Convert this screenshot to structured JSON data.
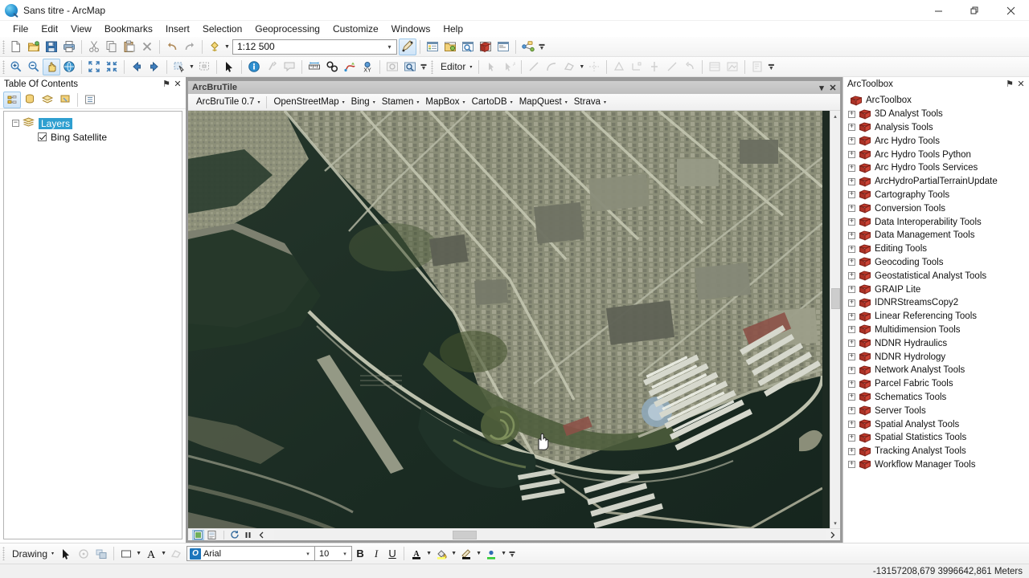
{
  "window": {
    "title": "Sans titre - ArcMap",
    "app_icon": "arcmap-globe-icon",
    "minimize": "—",
    "maximize": "❐",
    "close": "✕"
  },
  "menubar": {
    "items": [
      {
        "label": "File"
      },
      {
        "label": "Edit"
      },
      {
        "label": "View"
      },
      {
        "label": "Bookmarks"
      },
      {
        "label": "Insert"
      },
      {
        "label": "Selection"
      },
      {
        "label": "Geoprocessing"
      },
      {
        "label": "Customize"
      },
      {
        "label": "Windows"
      },
      {
        "label": "Help"
      }
    ]
  },
  "standard_toolbar": {
    "buttons": [
      {
        "name": "new-map-icon",
        "title": "New"
      },
      {
        "name": "open-icon",
        "title": "Open"
      },
      {
        "name": "save-icon",
        "title": "Save"
      },
      {
        "name": "print-icon",
        "title": "Print"
      },
      {
        "name": "cut-icon",
        "title": "Cut"
      },
      {
        "name": "copy-icon",
        "title": "Copy"
      },
      {
        "name": "paste-icon",
        "title": "Paste"
      },
      {
        "name": "delete-icon",
        "title": "Delete"
      },
      {
        "name": "undo-icon",
        "title": "Undo"
      },
      {
        "name": "redo-icon",
        "title": "Redo"
      },
      {
        "name": "add-data-icon",
        "title": "Add Data"
      }
    ],
    "scale": {
      "label": "Map Scale",
      "value": "1:12 500",
      "dropdown_caret": "▾"
    },
    "right_buttons": [
      {
        "name": "editor-toolbar-icon",
        "title": "Editor Toolbar",
        "active": true
      },
      {
        "name": "table-of-contents-icon",
        "title": "Table Of Contents"
      },
      {
        "name": "catalog-window-icon",
        "title": "Catalog"
      },
      {
        "name": "search-window-icon",
        "title": "Search"
      },
      {
        "name": "arctoolbox-window-icon",
        "title": "ArcToolbox"
      },
      {
        "name": "python-window-icon",
        "title": "Python"
      },
      {
        "name": "model-builder-icon",
        "title": "ModelBuilder"
      }
    ]
  },
  "tools_toolbar": {
    "buttons": [
      {
        "name": "zoom-in-icon",
        "title": "Zoom In"
      },
      {
        "name": "zoom-out-icon",
        "title": "Zoom Out"
      },
      {
        "name": "pan-icon",
        "title": "Pan",
        "active": true
      },
      {
        "name": "full-extent-icon",
        "title": "Full Extent"
      },
      {
        "name": "fixed-zoom-in-icon",
        "title": "Fixed Zoom In"
      },
      {
        "name": "fixed-zoom-out-icon",
        "title": "Fixed Zoom Out"
      },
      {
        "name": "go-back-extent-icon",
        "title": "Go Back To Previous Extent"
      },
      {
        "name": "go-next-extent-icon",
        "title": "Go To Next Extent"
      },
      {
        "name": "select-features-icon",
        "title": "Select Features"
      },
      {
        "name": "clear-selection-icon",
        "title": "Clear Selected Features"
      },
      {
        "name": "select-elements-icon",
        "title": "Select Elements"
      },
      {
        "name": "identify-icon",
        "title": "Identify"
      },
      {
        "name": "hyperlink-icon",
        "title": "Hyperlink"
      },
      {
        "name": "html-popup-icon",
        "title": "HTML Popup"
      },
      {
        "name": "measure-icon",
        "title": "Measure"
      },
      {
        "name": "find-icon",
        "title": "Find"
      },
      {
        "name": "find-route-icon",
        "title": "Find Route"
      },
      {
        "name": "go-to-xy-icon",
        "title": "Go To XY"
      },
      {
        "name": "time-slider-icon",
        "title": "Time Slider"
      },
      {
        "name": "create-viewer-window-icon",
        "title": "Create Viewer Window"
      }
    ],
    "editor": {
      "label": "Editor",
      "caret": "▾",
      "tools": [
        {
          "name": "edit-tool-icon",
          "title": "Edit Tool"
        },
        {
          "name": "edit-annotation-icon",
          "title": "Edit Annotation Tool"
        },
        {
          "name": "straight-segment-icon",
          "title": "Straight Segment"
        },
        {
          "name": "endpoint-arc-icon",
          "title": "End Point Arc Segment"
        },
        {
          "name": "trace-icon",
          "title": "Trace"
        },
        {
          "name": "split-icon",
          "title": "Split Tool"
        },
        {
          "name": "rotate-icon",
          "title": "Rotate Tool"
        },
        {
          "name": "reshape-icon",
          "title": "Reshape Feature Tool"
        },
        {
          "name": "mirror-icon",
          "title": "Mirror Features Tool"
        },
        {
          "name": "measure-edit-icon",
          "title": "Measure"
        },
        {
          "name": "undo-edit-icon",
          "title": "Attributes"
        },
        {
          "name": "attributes-table-icon",
          "title": "Attributes"
        },
        {
          "name": "sketch-properties-icon",
          "title": "Sketch Properties"
        },
        {
          "name": "create-features-icon",
          "title": "Create Features"
        }
      ]
    }
  },
  "table_of_contents": {
    "title": "Table Of Contents",
    "pin_icon": "⚑",
    "close_icon": "✕",
    "tools": [
      {
        "name": "list-by-drawing-order-icon",
        "title": "List By Drawing Order",
        "active": true
      },
      {
        "name": "list-by-source-icon",
        "title": "List By Source"
      },
      {
        "name": "list-by-visibility-icon",
        "title": "List By Visibility"
      },
      {
        "name": "list-by-selection-icon",
        "title": "List By Selection"
      },
      {
        "name": "toc-options-icon",
        "title": "Options"
      }
    ],
    "tree": {
      "root": {
        "label": "Layers",
        "expander": "−",
        "selected": true
      },
      "layers": [
        {
          "label": "Bing Satellite",
          "checked": true
        }
      ]
    }
  },
  "map_window": {
    "title": "ArcBruTile",
    "minimize_caret": "▾",
    "close_icon": "✕",
    "brutile_toolbar": [
      {
        "label": "ArcBruTile 0.7",
        "caret": "▾"
      },
      {
        "label": "OpenStreetMap",
        "caret": "▾"
      },
      {
        "label": "Bing",
        "caret": "▾"
      },
      {
        "label": "Stamen",
        "caret": "▾"
      },
      {
        "label": "MapBox",
        "caret": "▾"
      },
      {
        "label": "CartoDB",
        "caret": "▾"
      },
      {
        "label": "MapQuest",
        "caret": "▾"
      },
      {
        "label": "Strava",
        "caret": "▾"
      }
    ],
    "status_buttons": [
      {
        "name": "data-view-icon",
        "title": "Data View",
        "active": true
      },
      {
        "name": "layout-view-icon",
        "title": "Layout View"
      },
      {
        "name": "refresh-view-icon",
        "title": "Refresh View"
      },
      {
        "name": "pause-drawing-icon",
        "title": "Pause Drawing"
      },
      {
        "name": "previous-extent-icon",
        "title": "Previous Extent"
      }
    ],
    "scroll_up_caret": "▴",
    "scroll_down_caret": "▾",
    "cursor": "pan-hand-cursor"
  },
  "arctoolbox": {
    "title": "ArcToolbox",
    "pin_icon": "⚑",
    "close_icon": "✕",
    "root_label": "ArcToolbox",
    "items": [
      {
        "label": "3D Analyst Tools"
      },
      {
        "label": "Analysis Tools"
      },
      {
        "label": "Arc Hydro Tools"
      },
      {
        "label": "Arc Hydro Tools Python"
      },
      {
        "label": "Arc Hydro Tools Services"
      },
      {
        "label": "ArcHydroPartialTerrainUpdate"
      },
      {
        "label": "Cartography Tools"
      },
      {
        "label": "Conversion Tools"
      },
      {
        "label": "Data Interoperability Tools"
      },
      {
        "label": "Data Management Tools"
      },
      {
        "label": "Editing Tools"
      },
      {
        "label": "Geocoding Tools"
      },
      {
        "label": "Geostatistical Analyst Tools"
      },
      {
        "label": "GRAIP Lite"
      },
      {
        "label": "IDNRStreamsCopy2"
      },
      {
        "label": "Linear Referencing Tools"
      },
      {
        "label": "Multidimension Tools"
      },
      {
        "label": "NDNR Hydraulics"
      },
      {
        "label": "NDNR Hydrology"
      },
      {
        "label": "Network Analyst Tools"
      },
      {
        "label": "Parcel Fabric Tools"
      },
      {
        "label": "Schematics Tools"
      },
      {
        "label": "Server Tools"
      },
      {
        "label": "Spatial Analyst Tools"
      },
      {
        "label": "Spatial Statistics Tools"
      },
      {
        "label": "Tracking Analyst Tools"
      },
      {
        "label": "Workflow Manager Tools"
      }
    ],
    "expander": "+"
  },
  "drawing_toolbar": {
    "label": "Drawing",
    "caret": "▾",
    "buttons": [
      {
        "name": "select-elements-icon",
        "title": "Select Elements"
      },
      {
        "name": "rotate-element-icon",
        "title": "Rotate"
      },
      {
        "name": "arrange-icon",
        "title": "Arrange"
      },
      {
        "name": "new-rectangle-icon",
        "title": "Drawing Shape"
      },
      {
        "name": "new-text-icon",
        "title": "New Text"
      },
      {
        "name": "edit-vertices-icon",
        "title": "Edit Vertices"
      }
    ],
    "font": {
      "value": "Arial",
      "icon": "font-o-icon",
      "caret": "▾"
    },
    "size": {
      "value": "10",
      "caret": "▾"
    },
    "styles": [
      {
        "name": "bold-button",
        "label": "B"
      },
      {
        "name": "italic-button",
        "label": "I"
      },
      {
        "name": "underline-button",
        "label": "U"
      }
    ],
    "colors": [
      {
        "name": "font-color-button",
        "label": "A",
        "color": "#000000",
        "caret": "▾"
      },
      {
        "name": "fill-color-button",
        "label": "fill",
        "color": "#ffff66",
        "caret": "▾"
      },
      {
        "name": "line-color-button",
        "label": "line",
        "color": "#000000",
        "caret": "▾"
      },
      {
        "name": "marker-color-button",
        "label": "marker",
        "color": "#33cc33",
        "caret": "▾"
      }
    ]
  },
  "status_bar": {
    "coordinates": "-13157208,679  3996642,861 Meters"
  },
  "colors": {
    "accent": "#2f9fd0",
    "toolbox_red": "#b5342b",
    "water": "#1e3228",
    "land": "#8c8f78"
  }
}
